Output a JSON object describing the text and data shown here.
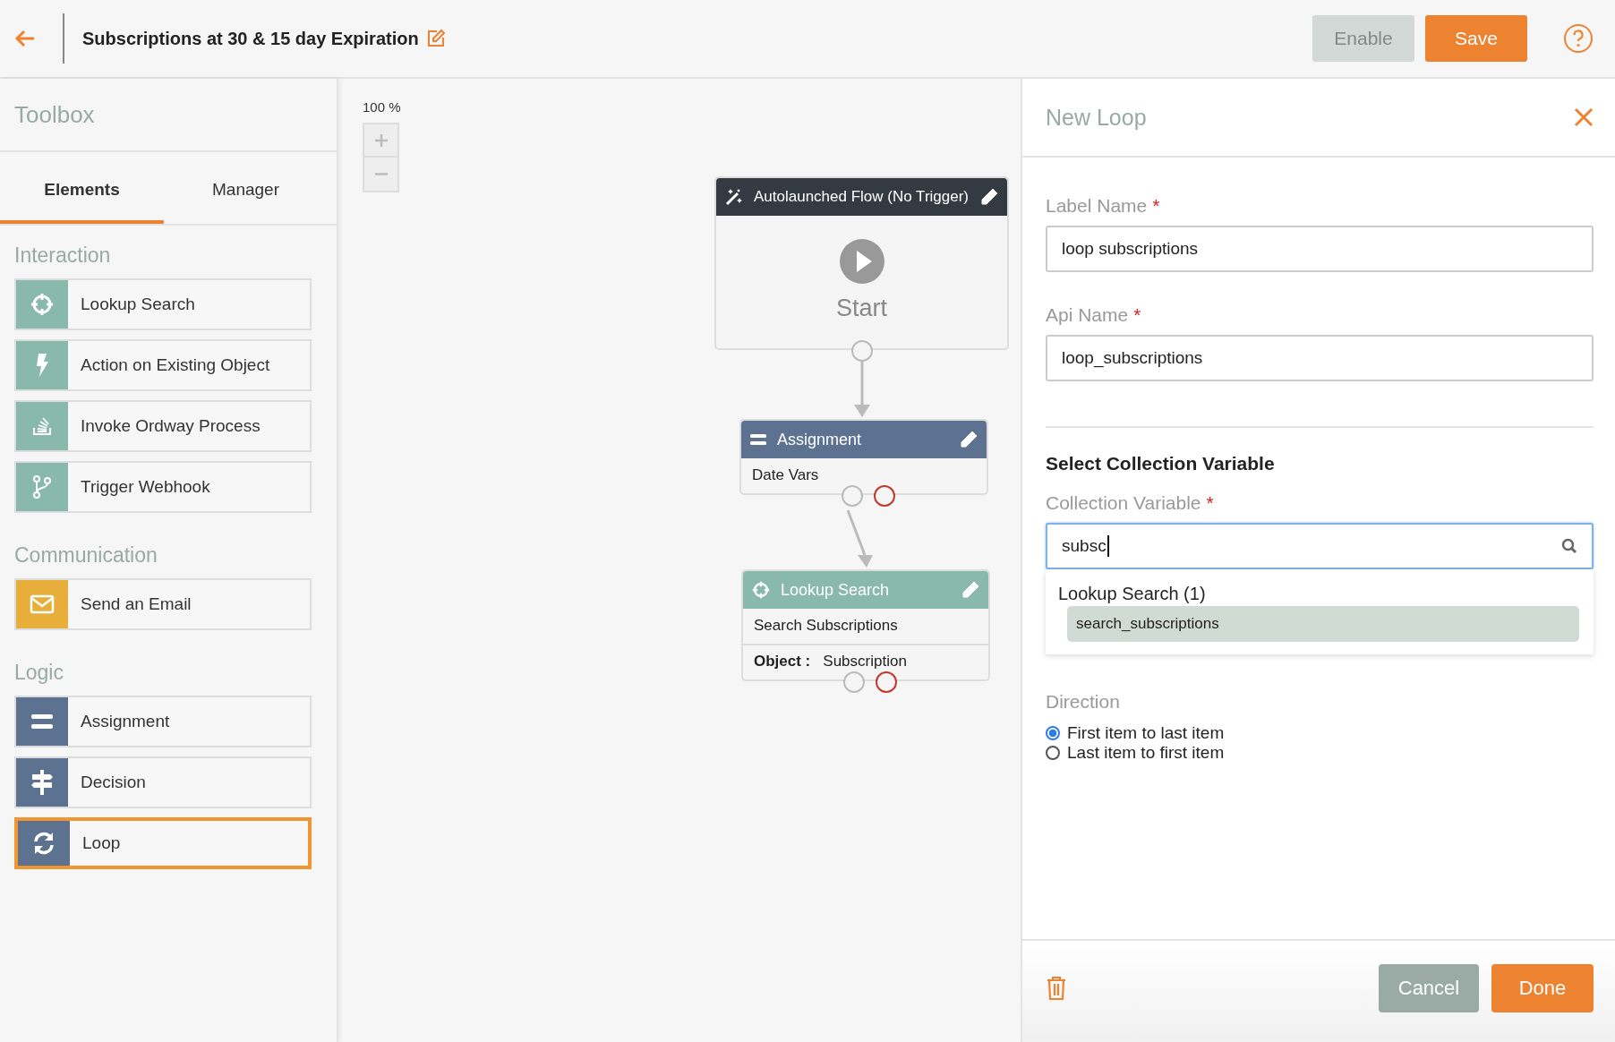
{
  "header": {
    "title": "Subscriptions at 30 & 15 day Expiration",
    "buttons": [
      {
        "label": "Enable",
        "disabled": true
      },
      {
        "label": "Save",
        "disabled": false
      }
    ]
  },
  "toolbox": {
    "title": "Toolbox",
    "tabs": [
      {
        "label": "Elements",
        "selected": true
      },
      {
        "label": "Manager",
        "selected": false
      }
    ],
    "groups": [
      {
        "title": "Interaction",
        "color": "#88b9aa",
        "items": [
          {
            "label": "Lookup Search",
            "kind": "lookup",
            "selected": false
          },
          {
            "label": "Action on Existing Object",
            "kind": "action",
            "selected": false
          },
          {
            "label": "Invoke Ordway Process",
            "kind": "invoke",
            "selected": false
          },
          {
            "label": "Trigger Webhook",
            "kind": "webhook",
            "selected": false
          }
        ]
      },
      {
        "title": "Communication",
        "color": "#e8ae3a",
        "items": [
          {
            "label": "Send an Email",
            "kind": "email",
            "selected": false
          }
        ]
      },
      {
        "title": "Logic",
        "color": "#5c7290",
        "items": [
          {
            "label": "Assignment",
            "kind": "assignment",
            "selected": false
          },
          {
            "label": "Decision",
            "kind": "decision",
            "selected": false
          },
          {
            "label": "Loop",
            "kind": "loop",
            "selected": true
          }
        ]
      }
    ]
  },
  "canvas": {
    "zoom": "100 %",
    "nodes": [
      {
        "kind": "start",
        "title": "Autolaunched Flow (No Trigger)",
        "label": "Start"
      },
      {
        "kind": "assignment",
        "title": "Assignment",
        "description": "Date Vars"
      },
      {
        "kind": "lookup",
        "title": "Lookup Search",
        "description": "Search Subscriptions",
        "object_label": "Object :",
        "object_value": "Subscription"
      }
    ]
  },
  "panel": {
    "title": "New Loop",
    "fields": [
      {
        "label": "Label Name",
        "required_mark": "*",
        "value": "loop subscriptions"
      },
      {
        "label": "Api Name",
        "required_mark": "*",
        "value": "loop_subscriptions"
      }
    ],
    "section_title": "Select Collection Variable",
    "collection": {
      "label": "Collection Variable",
      "required_mark": "*",
      "value": "subsc"
    },
    "dropdown": {
      "group": "Lookup Search (1)",
      "options": [
        {
          "label": "search_subscriptions",
          "selected": true
        }
      ]
    },
    "direction": {
      "label": "Direction",
      "options": [
        {
          "label": "First item to last item",
          "selected": true
        },
        {
          "label": "Last item to first item",
          "selected": false
        }
      ]
    },
    "buttons": [
      {
        "label": "Cancel",
        "kind": "secondary"
      },
      {
        "label": "Done",
        "kind": "primary"
      }
    ]
  }
}
